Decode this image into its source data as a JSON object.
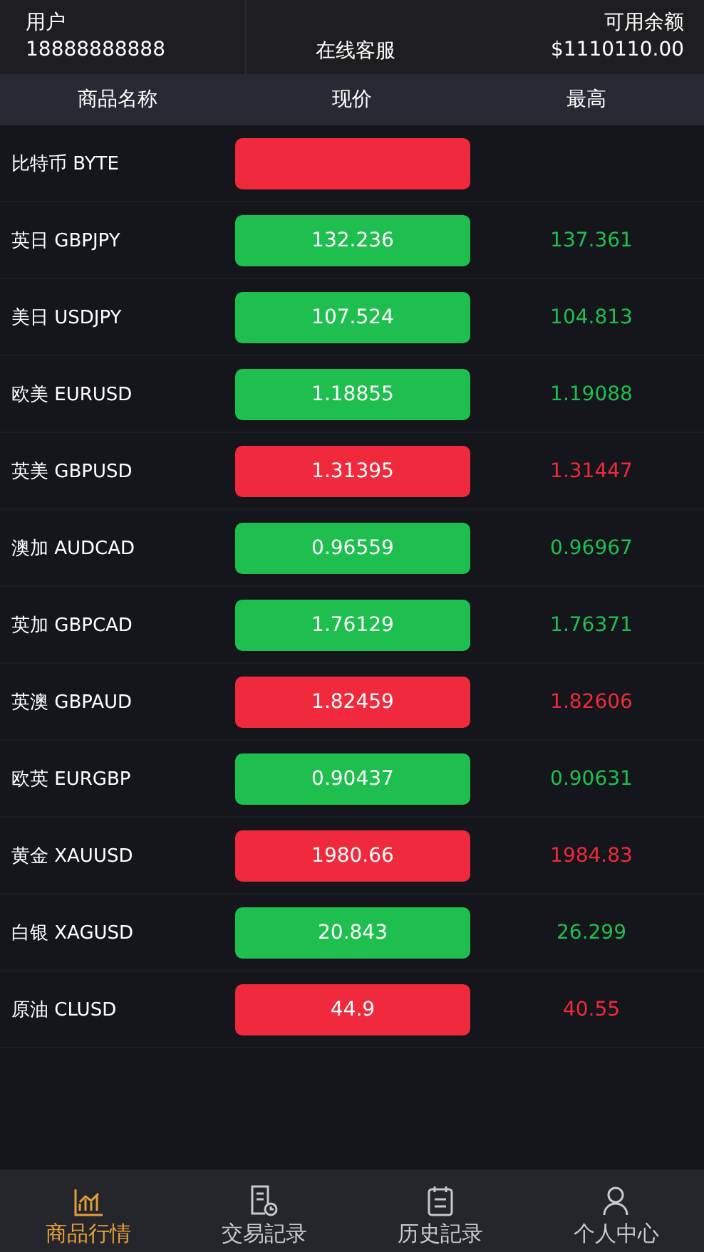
{
  "header": {
    "user_label": "用户",
    "user_phone": "18888888888",
    "service": "在线客服",
    "balance_label": "可用余额",
    "balance": "$1110110.00"
  },
  "table": {
    "columns": [
      "商品名称",
      "现价",
      "最高"
    ],
    "rows": [
      {
        "name": "比特币 BYTE",
        "color": "#f02a3c"
      },
      {
        "name": "英日 GBPJPY",
        "price": "132.236",
        "high": "137.361",
        "color": "#1fbf4f"
      },
      {
        "name": "美日 USDJPY",
        "price": "107.524",
        "high": "104.813",
        "color": "#1fbf4f"
      },
      {
        "name": "欧美 EURUSD",
        "price": "1.18855",
        "high": "1.19088",
        "color": "#1fbf4f"
      },
      {
        "name": "英美 GBPUSD",
        "price": "1.31395",
        "high": "1.31447",
        "color": "#f02a3c"
      },
      {
        "name": "澳加 AUDCAD",
        "price": "0.96559",
        "high": "0.96967",
        "color": "#1fbf4f"
      },
      {
        "name": "英加 GBPCAD",
        "price": "1.76129",
        "high": "1.76371",
        "color": "#1fbf4f"
      },
      {
        "name": "英澳 GBPAUD",
        "price": "1.82459",
        "high": "1.82606",
        "color": "#f02a3c"
      },
      {
        "name": "欧英 EURGBP",
        "price": "0.90437",
        "high": "0.90631",
        "color": "#1fbf4f"
      },
      {
        "name": "黄金 XAUUSD",
        "price": "1980.66",
        "high": "1984.83",
        "color": "#f02a3c"
      },
      {
        "name": "白银 XAGUSD",
        "price": "20.843",
        "high": "26.299",
        "color": "#1fbf4f"
      },
      {
        "name": "原油 CLUSD",
        "price": "44.9",
        "high": "40.55",
        "color": "#f02a3c"
      }
    ]
  },
  "tabbar": [
    {
      "label": "商品行情",
      "selected": true
    },
    {
      "label": "交易記录",
      "selected": false
    },
    {
      "label": "历史記录",
      "selected": false
    },
    {
      "label": "个人中心",
      "selected": false
    }
  ]
}
